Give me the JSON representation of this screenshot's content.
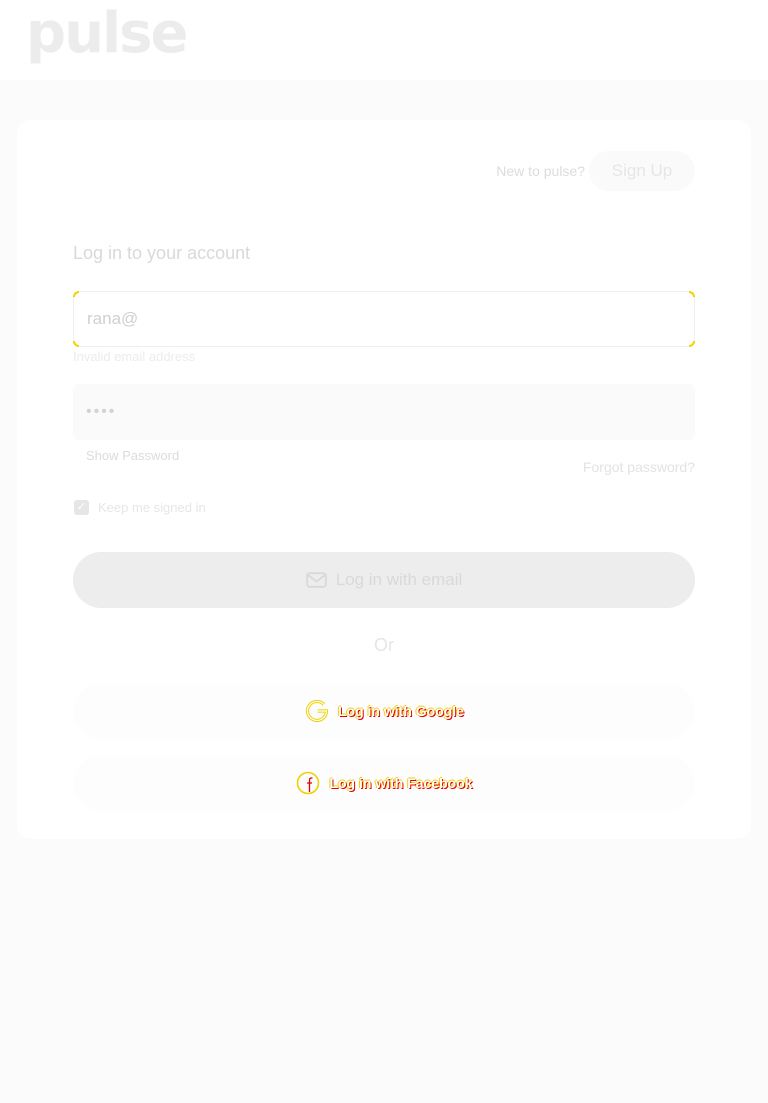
{
  "header": {
    "logo_text": "pulse"
  },
  "signup": {
    "prompt": "New to pulse?",
    "button_label": "Sign Up"
  },
  "form": {
    "heading": "Log in to your account",
    "email": {
      "value": "rana@",
      "error": "Invalid email address"
    },
    "password": {
      "masked_value": "••••",
      "show_label": "Show Password",
      "forgot_label": "Forgot password?"
    },
    "keep_signed_in": {
      "label": "Keep me signed in",
      "checked": true
    },
    "email_login_label": "Log in with email",
    "or_label": "Or",
    "google_label": "Log in with Google",
    "facebook_label": "Log in with Facebook"
  },
  "colors": {
    "accent_outline": "#f1d300",
    "social_text_shadow": "#e00000"
  },
  "icons": [
    "mail-icon",
    "google-icon",
    "facebook-icon",
    "check-icon"
  ]
}
